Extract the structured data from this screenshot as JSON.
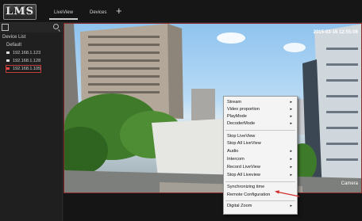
{
  "app": {
    "logo": "LMS"
  },
  "tabs": [
    {
      "label": "LiveView"
    },
    {
      "label": "Devices"
    }
  ],
  "add_tab_symbol": "+",
  "sidebar": {
    "title": "Device List",
    "group": "Default",
    "devices": [
      {
        "ip": "192.168.1.123"
      },
      {
        "ip": "192.168.1.128"
      },
      {
        "ip": "192.168.1.105"
      }
    ]
  },
  "video": {
    "timestamp": "2015-03-16 12:55:06",
    "camera_label": "Camera"
  },
  "context_menu": {
    "items": [
      {
        "label": "Stream",
        "submenu": true
      },
      {
        "label": "Video proportion",
        "submenu": true
      },
      {
        "label": "PlayMode",
        "submenu": true
      },
      {
        "label": "DecoderMode",
        "submenu": true
      },
      {
        "label": "Stop LiveView",
        "submenu": false
      },
      {
        "label": "Stop All LiveView",
        "submenu": false
      },
      {
        "label": "Audio",
        "submenu": true
      },
      {
        "label": "Intercom",
        "submenu": true
      },
      {
        "label": "Record LiveView",
        "submenu": true
      },
      {
        "label": "Stop All Liveview",
        "submenu": true
      },
      {
        "label": "Synchronizing time",
        "submenu": false
      },
      {
        "label": "Remote Configuration",
        "submenu": false
      },
      {
        "label": "Digital Zoom",
        "submenu": true
      }
    ]
  },
  "colors": {
    "highlight": "#c23b3b",
    "annotation_arrow": "#d23030"
  }
}
